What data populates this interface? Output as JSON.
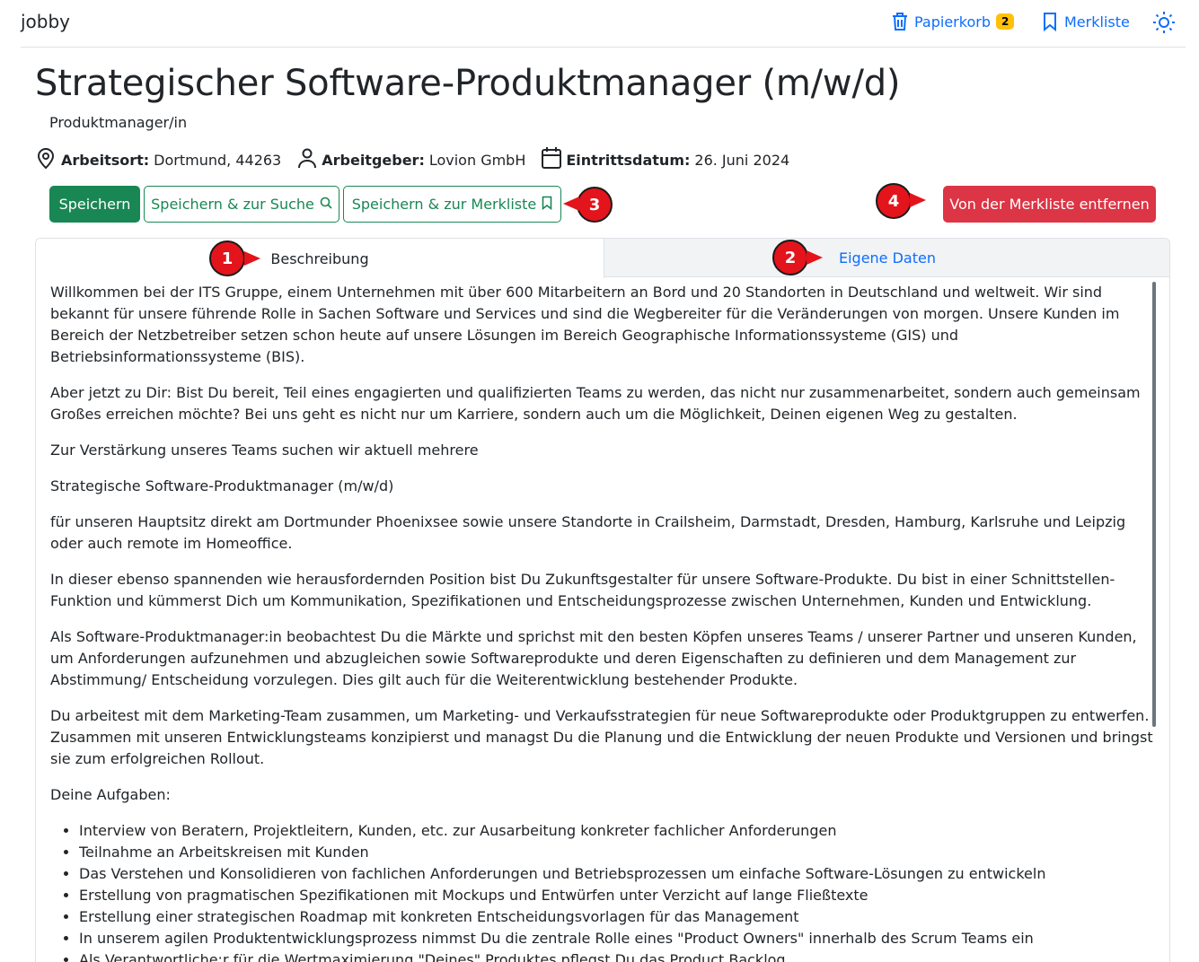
{
  "navbar": {
    "brand": "jobby",
    "trash_label": "Papierkorb",
    "trash_count": "2",
    "bookmarks_label": "Merkliste",
    "theme_icon": "sun-icon"
  },
  "job": {
    "title": "Strategischer Software-Produktmanager (m/w/d)",
    "subtitle": "Produktmanager/in",
    "location_label": "Arbeitsort:",
    "location_value": "Dortmund, 44263",
    "employer_label": "Arbeitgeber:",
    "employer_value": "Lovion GmbH",
    "start_label": "Eintrittsdatum:",
    "start_value": "26. Juni 2024"
  },
  "actions": {
    "save": "Speichern",
    "save_search": "Speichern & zur Suche",
    "save_bookmarks": "Speichern & zur Merkliste",
    "remove": "Von der Merkliste entfernen"
  },
  "markers": [
    "1",
    "2",
    "3",
    "4"
  ],
  "tabs": {
    "description": "Beschreibung",
    "own_data": "Eigene Daten"
  },
  "description": {
    "paragraphs": [
      "Willkommen bei der ITS Gruppe, einem Unternehmen mit über 600 Mitarbeitern an Bord und 20 Standorten in Deutschland und weltweit. Wir sind bekannt für unsere führende Rolle in Sachen Software und Services und sind die Wegbereiter für die Veränderungen von morgen. Unsere Kunden im Bereich der Netzbetreiber setzen schon heute auf unsere Lösungen im Bereich Geographische Informationssysteme (GIS) und Betriebsinformationssysteme (BIS).",
      "Aber jetzt zu Dir: Bist Du bereit, Teil eines engagierten und qualifizierten Teams zu werden, das nicht nur zusammenarbeitet, sondern auch gemeinsam Großes erreichen möchte? Bei uns geht es nicht nur um Karriere, sondern auch um die Möglichkeit, Deinen eigenen Weg zu gestalten.",
      "Zur Verstärkung unseres Teams suchen wir aktuell mehrere",
      "Strategische Software-Produktmanager (m/w/d)",
      "für unseren Hauptsitz direkt am Dortmunder Phoenixsee sowie unsere Standorte in Crailsheim, Darmstadt, Dresden, Hamburg, Karlsruhe und Leipzig oder auch remote im Homeoffice.",
      "In dieser ebenso spannenden wie herausfordernden Position bist Du Zukunftsgestalter für unsere Software-Produkte. Du bist in einer Schnittstellen-Funktion und kümmerst Dich um Kommunikation, Spezifikationen und Entscheidungsprozesse zwischen Unternehmen, Kunden und Entwicklung.",
      "Als Software-Produktmanager:in beobachtest Du die Märkte und sprichst mit den besten Köpfen unseres Teams / unserer Partner und unseren Kunden, um Anforderungen aufzunehmen und abzugleichen sowie Softwareprodukte und deren Eigenschaften zu definieren und dem Management zur Abstimmung/ Entscheidung vorzulegen. Dies gilt auch für die Weiterentwicklung bestehender Produkte.",
      "Du arbeitest mit dem Marketing-Team zusammen, um Marketing- und Verkaufsstrategien für neue Softwareprodukte oder Produktgruppen zu entwerfen. Zusammen mit unseren Entwicklungsteams konzipierst und managst Du die Planung und die Entwicklung der neuen Produkte und Versionen und bringst sie zum erfolgreichen Rollout.",
      "Deine Aufgaben:"
    ],
    "tasks": [
      "Interview von Beratern, Projektleitern, Kunden, etc. zur Ausarbeitung konkreter fachlicher Anforderungen",
      "Teilnahme an Arbeitskreisen mit Kunden",
      "Das Verstehen und Konsolidieren von fachlichen Anforderungen und Betriebsprozessen um einfache Software-Lösungen zu entwickeln",
      "Erstellung von pragmatischen Spezifikationen mit Mockups und Entwürfen unter Verzicht auf lange Fließtexte",
      "Erstellung einer strategischen Roadmap mit konkreten Entscheidungsvorlagen für das Management",
      "In unserem agilen Produktentwicklungsprozess nimmst Du die zentrale Rolle eines \"Product Owners\" innerhalb des Scrum Teams ein",
      "Als Verantwortliche:r für die Wertmaximierung \"Deines\" Produktes pflegst Du das Product Backlog"
    ]
  }
}
